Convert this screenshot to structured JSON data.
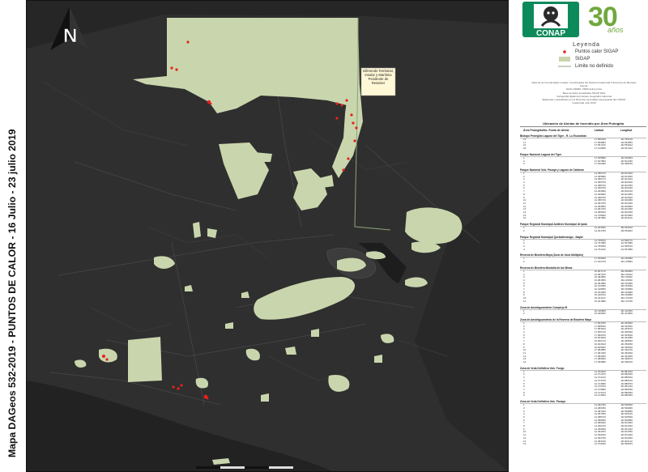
{
  "map_title": "Mapa DAGeos 532-2019 - PUNTOS DE CALOR - 16 Julio - 23 julio 2019",
  "north_label": "N",
  "map_callout": "Diferendo Territorial, Insular y Marítimo Pendiente de Resolver",
  "logo": {
    "name": "CONAP",
    "anniversary": "30",
    "anniversary_word": "años"
  },
  "legend": {
    "title": "Leyenda",
    "items": [
      {
        "label": "Puntos calor SIGAP",
        "color": "#e8211c",
        "symbol": "point-icon"
      },
      {
        "label": "SIGAP",
        "color": "#c9d6ad",
        "symbol": "area-swatch-icon"
      },
      {
        "label": "Limite no definido",
        "color": "#8da27a",
        "symbol": "line-icon"
      }
    ]
  },
  "credits": [
    "Sistema de Coordenadas Locales, Coordenadas del Sistema Guatemala Transversa de Mercator",
    "Fuente:",
    "NASA FIRMS: VIIRS Active Fires",
    "Base de datos actualizada SIGAP 2019",
    "Cartografía digital del Instituto Geográfico Nacional",
    "Elaborado y actualizado por la Dirección de Análisis Geoespacial del CONAP",
    "Guatemala, julio 2019"
  ],
  "alerts_table": {
    "title": "Ubicación de Alertas de Incendio por Área Protegida",
    "headers": [
      "Área Protegida/No. Punto de Alerta",
      "Latitud",
      "Longitud"
    ],
    "sections": [
      {
        "name": "Biotopo Protegido Laguna del Tigre - R. Lu Escondido",
        "rows": [
          [
            "12",
            "17.580940",
            "-90.755125"
          ],
          [
            "17",
            "17.559883",
            "-90.653855"
          ],
          [
            "21",
            "17.551370",
            "-90.553622"
          ],
          [
            "22",
            "17.130855",
            "-90.521422"
          ]
        ]
      },
      {
        "name": "Parque Nacional Laguna del Tigre",
        "rows": [
          [
            "1",
            "17.535880",
            "-90.515893"
          ],
          [
            "2",
            "17.527850",
            "-90.501250"
          ],
          [
            "3",
            "17.520380",
            "-90.498150"
          ]
        ]
      },
      {
        "name": "Parque Nacional Volc. Pacaya y Laguna de Calderas",
        "rows": [
          [
            "1",
            "14.380470",
            "-90.601520"
          ],
          [
            "2",
            "14.385880",
            "-90.601850"
          ],
          [
            "3",
            "14.386170",
            "-90.601910"
          ],
          [
            "4",
            "14.386750",
            "-90.602000"
          ],
          [
            "5",
            "14.388720",
            "-90.602350"
          ],
          [
            "6",
            "14.390750",
            "-90.602450"
          ],
          [
            "7",
            "14.393830",
            "-90.602150"
          ],
          [
            "8",
            "14.395800",
            "-90.601950"
          ],
          [
            "9",
            "14.388750",
            "-90.602500"
          ],
          [
            "10",
            "14.386730",
            "-90.602980"
          ],
          [
            "11",
            "14.384750",
            "-90.603450"
          ],
          [
            "12",
            "14.382850",
            "-90.603850"
          ],
          [
            "13",
            "14.381750",
            "-90.604480"
          ],
          [
            "14",
            "14.380520",
            "-90.602350"
          ],
          [
            "15",
            "14.378900",
            "-90.601850"
          ],
          [
            "16",
            "14.387880",
            "-90.601120"
          ]
        ]
      },
      {
        "name": "Parque Regional Municipal Astillero Municipal de Ipala",
        "rows": [
          [
            "1",
            "14.464500",
            "-89.653910"
          ],
          [
            "2",
            "14.461780",
            "-89.653840"
          ]
        ]
      },
      {
        "name": "Parque Regional Municipal Quetzaltenango - Saqbé",
        "rows": [
          [
            "1",
            "14.799510",
            "-91.568770"
          ],
          [
            "2",
            "14.797880",
            "-91.567880"
          ],
          [
            "3",
            "14.785950",
            "-91.565510"
          ],
          [
            "4",
            "14.794010",
            "-91.567880"
          ]
        ]
      },
      {
        "name": "Reserva de Biosfera Maya (Zona de Usos Múltiples)",
        "rows": [
          [
            "1",
            "17.259900",
            "-90.180980"
          ],
          [
            "2",
            "17.182740",
            "-90.178860"
          ]
        ]
      },
      {
        "name": "Reserva de Biosfera Montaña de las Minas",
        "rows": [
          [
            "1",
            "16.957170",
            "-89.260860"
          ],
          [
            "2",
            "16.957150",
            "-89.115400"
          ],
          [
            "3",
            "16.084850",
            "-89.115990"
          ],
          [
            "4",
            "16.081850",
            "-89.115990"
          ],
          [
            "5",
            "16.081880",
            "-89.105480"
          ],
          [
            "6",
            "16.315380",
            "-89.159560"
          ],
          [
            "7",
            "16.318580",
            "-89.159880"
          ],
          [
            "8",
            "16.324480",
            "-89.166980"
          ],
          [
            "9",
            "16.320510",
            "-89.169880"
          ],
          [
            "10",
            "16.321110",
            "-89.170150"
          ],
          [
            "11",
            "16.321880",
            "-89.170750"
          ]
        ]
      },
      {
        "name": "Zona de Amortiguamiento Complejo III",
        "rows": [
          [
            "1",
            "16.410800",
            "-90.412050"
          ],
          [
            "2",
            "16.406950",
            "-90.412800"
          ]
        ]
      },
      {
        "name": "Zona de Amortiguamiento de la Reserva de Biosfera Maya",
        "rows": [
          [
            "1",
            "17.584780",
            "-90.283650"
          ],
          [
            "2",
            "17.588530",
            "-90.363530"
          ],
          [
            "3",
            "17.584810",
            "-90.363570"
          ],
          [
            "4",
            "17.595710",
            "-90.360990"
          ],
          [
            "5",
            "17.582150",
            "-90.363590"
          ],
          [
            "6",
            "16.904920",
            "-90.361880"
          ],
          [
            "7",
            "16.956710",
            "-90.358550"
          ],
          [
            "8",
            "16.604610",
            "-90.359350"
          ],
          [
            "9",
            "16.605820",
            "-90.360820"
          ],
          [
            "10",
            "17.082880",
            "-90.360700"
          ],
          [
            "11",
            "17.081450",
            "-90.360990"
          ],
          [
            "12",
            "17.082950",
            "-90.361900"
          ],
          [
            "13",
            "17.089960",
            "-90.358670"
          ],
          [
            "14",
            "17.092880",
            "-90.360610"
          ]
        ]
      },
      {
        "name": "Zona de Veda Definitiva Volc. Fuego",
        "rows": [
          [
            "1",
            "14.462520",
            "-90.881920"
          ],
          [
            "2",
            "14.471070",
            "-90.880090"
          ],
          [
            "3",
            "14.474120",
            "-90.880520"
          ],
          [
            "4",
            "14.474760",
            "-90.880610"
          ],
          [
            "5",
            "14.473880",
            "-90.880870"
          ],
          [
            "6",
            "14.475700",
            "-90.881240"
          ],
          [
            "7",
            "14.476880",
            "-90.880590"
          ],
          [
            "8",
            "14.473370",
            "-90.880950"
          ],
          [
            "9",
            "14.473850",
            "-90.880580"
          ]
        ]
      },
      {
        "name": "Zona de Veda Definitiva Volc. Pacaya",
        "rows": [
          [
            "1",
            "14.384790",
            "-90.599500"
          ],
          [
            "2",
            "14.386350",
            "-90.599680"
          ],
          [
            "3",
            "14.387940",
            "-90.599880"
          ],
          [
            "4",
            "14.387950",
            "-90.600190"
          ],
          [
            "5",
            "14.388740",
            "-90.600590"
          ],
          [
            "6",
            "14.388950",
            "-90.600880"
          ],
          [
            "7",
            "14.389930",
            "-90.601060"
          ],
          [
            "8",
            "14.390470",
            "-90.601340"
          ],
          [
            "9",
            "14.390690",
            "-90.601440"
          ],
          [
            "10",
            "14.391870",
            "-90.601550"
          ],
          [
            "11",
            "14.392940",
            "-90.601960"
          ],
          [
            "12",
            "14.393790",
            "-90.602050"
          ],
          [
            "13",
            "14.384010",
            "-90.602110"
          ],
          [
            "14",
            "14.379460",
            "-90.596870"
          ]
        ]
      }
    ]
  }
}
